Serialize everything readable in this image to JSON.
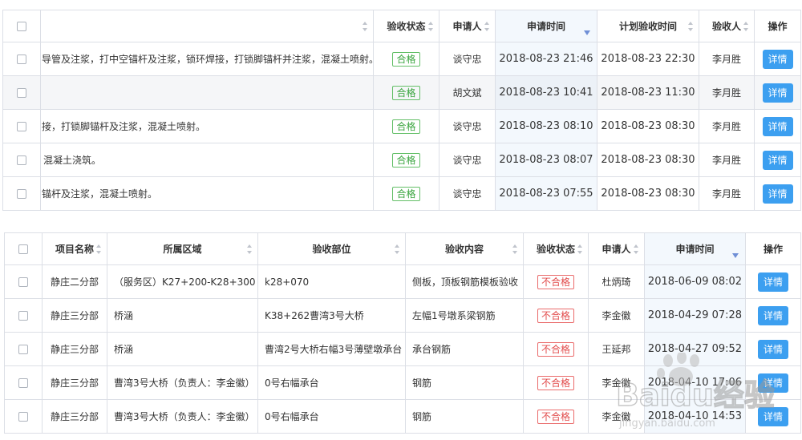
{
  "table1": {
    "headers": {
      "content": "",
      "status": "验收状态",
      "applicant": "申请人",
      "apply_time": "申请时间",
      "plan_time": "计划验收时间",
      "inspector": "验收人",
      "action": "操作"
    },
    "rows": [
      {
        "content": "导管及注浆，打中空锚杆及注浆，锁环焊接，打锁脚锚杆并注浆，混凝土喷射。",
        "status": "合格",
        "applicant": "谈守忠",
        "apply_time": "2018-08-23 21:46",
        "plan_time": "2018-08-23 22:30",
        "inspector": "李月胜",
        "action": "详情"
      },
      {
        "content": "",
        "status": "合格",
        "applicant": "胡文斌",
        "apply_time": "2018-08-23 10:41",
        "plan_time": "2018-08-23 11:30",
        "inspector": "李月胜",
        "action": "详情"
      },
      {
        "content": "接，打锁脚锚杆及注浆，混凝土喷射。",
        "status": "合格",
        "applicant": "谈守忠",
        "apply_time": "2018-08-23 08:10",
        "plan_time": "2018-08-23 08:30",
        "inspector": "李月胜",
        "action": "详情"
      },
      {
        "content": "混凝土浇筑。",
        "status": "合格",
        "applicant": "谈守忠",
        "apply_time": "2018-08-23 08:07",
        "plan_time": "2018-08-23 08:30",
        "inspector": "李月胜",
        "action": "详情"
      },
      {
        "content": "锚杆及注浆，混凝土喷射。",
        "status": "合格",
        "applicant": "谈守忠",
        "apply_time": "2018-08-23 07:55",
        "plan_time": "2018-08-23 08:30",
        "inspector": "李月胜",
        "action": "详情"
      }
    ]
  },
  "table2": {
    "headers": {
      "project": "项目名称",
      "region": "所属区域",
      "part": "验收部位",
      "content": "验收内容",
      "status": "验收状态",
      "applicant": "申请人",
      "apply_time": "申请时间",
      "action": "操作"
    },
    "rows": [
      {
        "project": "静庄二分部",
        "region": "（服务区）K27+200-K28+300",
        "part": "k28+070",
        "content": "侧板，顶板钢筋模板验收",
        "status": "不合格",
        "applicant": "杜炳琦",
        "apply_time": "2018-06-09 08:02",
        "action": "详情"
      },
      {
        "project": "静庄三分部",
        "region": "桥涵",
        "part": "K38+262曹湾3号大桥",
        "content": "左幅1号墩系梁钢筋",
        "status": "不合格",
        "applicant": "李金徽",
        "apply_time": "2018-04-29 07:28",
        "action": "详情"
      },
      {
        "project": "静庄三分部",
        "region": "桥涵",
        "part": "曹湾2号大桥右幅3号薄壁墩承台",
        "content": "承台钢筋",
        "status": "不合格",
        "applicant": "王延邦",
        "apply_time": "2018-04-27 09:52",
        "action": "详情"
      },
      {
        "project": "静庄三分部",
        "region": "曹湾3号大桥（负责人：李金徽）",
        "part": "0号右幅承台",
        "content": "钢筋",
        "status": "不合格",
        "applicant": "李金徽",
        "apply_time": "2018-04-10 17:06",
        "action": "详情"
      },
      {
        "project": "静庄三分部",
        "region": "曹湾3号大桥（负责人：李金徽）",
        "part": "0号右幅承台",
        "content": "钢筋",
        "status": "不合格",
        "applicant": "李金徽",
        "apply_time": "2018-04-10 14:53",
        "action": "详情"
      }
    ]
  },
  "watermark": {
    "brand": "Baidu经验",
    "url": "jingyan.baidu.com"
  }
}
